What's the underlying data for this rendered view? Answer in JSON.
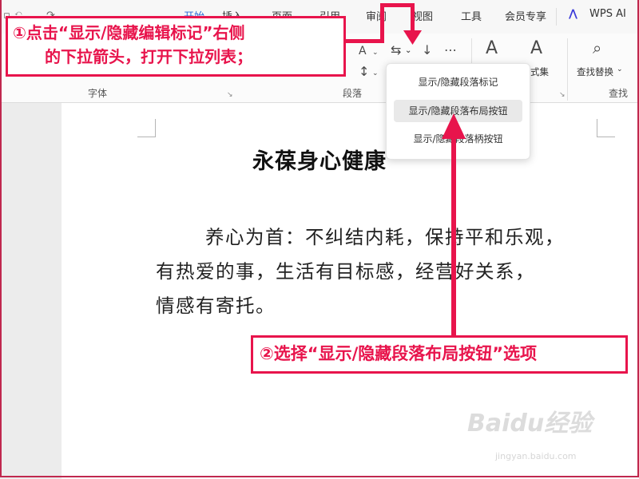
{
  "menubar": {
    "tabs": [
      "开始",
      "插入",
      "页面",
      "引用",
      "审阅",
      "视图",
      "工具",
      "会员专享",
      "WPS AI"
    ]
  },
  "ribbon": {
    "group_font_label": "字体",
    "group_paragraph_label": "段落",
    "group_find_label": "查找",
    "styles_partial_label": "式集",
    "find_replace_label": "查找替换"
  },
  "dropdown": {
    "items": [
      "显示/隐藏段落标记",
      "显示/隐藏段落布局按钮",
      "显示/隐藏段落柄按钮"
    ],
    "selected_index": 1
  },
  "document": {
    "title": "永葆身心健康",
    "body_lines": [
      "养心为首：不纠结内耗，保持平和乐观，",
      "有热爱的事，生活有目标感，经营好关系，",
      "情感有寄托。"
    ]
  },
  "annotations": {
    "step1_line1": "①点击“显示/隐藏编辑标记”右侧",
    "step1_line2": "的下拉箭头，打开下拉列表；",
    "step2": "②选择“显示/隐藏段落布局按钮”选项",
    "color": "#e8144c"
  },
  "watermark": {
    "text": "Baidu经验",
    "url_text": "jingyan.baidu.com"
  }
}
